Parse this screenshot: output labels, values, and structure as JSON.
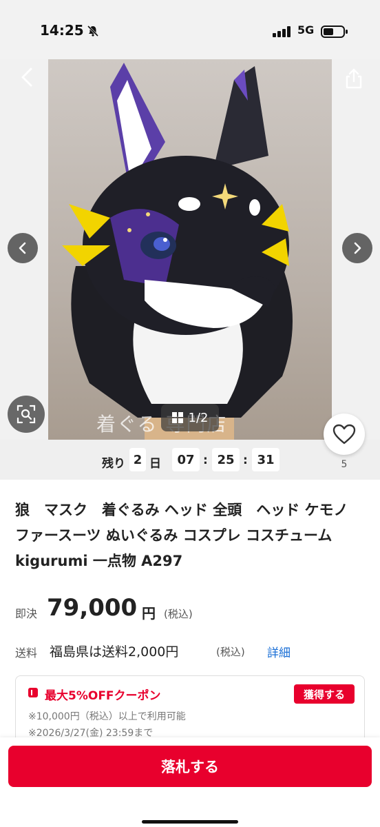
{
  "status_bar": {
    "time": "14:25",
    "network": "5G"
  },
  "gallery": {
    "counter": "1/2",
    "watermark": "着ぐる 専門店",
    "icons": [
      "back-icon",
      "share-icon",
      "chevron-left-icon",
      "chevron-right-icon",
      "image-search-icon",
      "grid-icon"
    ]
  },
  "countdown": {
    "label": "残り",
    "days": "2",
    "days_unit": "日",
    "hours": "07",
    "minutes": "25",
    "seconds": "31",
    "sep": ":"
  },
  "favorite": {
    "count": "5"
  },
  "product": {
    "title": "狼　マスク　着ぐるみ ヘッド 全頭　ヘッド ケモノ ファースーツ ぬいぐるみ コスプレ コスチューム kigurumi 一点物 A297"
  },
  "price": {
    "label": "即決",
    "value": "79,000",
    "unit": "円",
    "tax": "(税込)"
  },
  "shipping": {
    "label": "送料",
    "value": "福島県は送料2,000円",
    "tax": "(税込)",
    "detail_link": "詳細"
  },
  "coupon": {
    "title": "最大5%OFFクーポン",
    "get_label": "獲得する",
    "condition": "※10,000円（税込）以上で利用可能",
    "expiry": "※2026/3/27(金) 23:59まで"
  },
  "actions": {
    "bid_label": "落札する"
  },
  "colors": {
    "accent": "#e8002d",
    "link": "#1a6fd6"
  }
}
